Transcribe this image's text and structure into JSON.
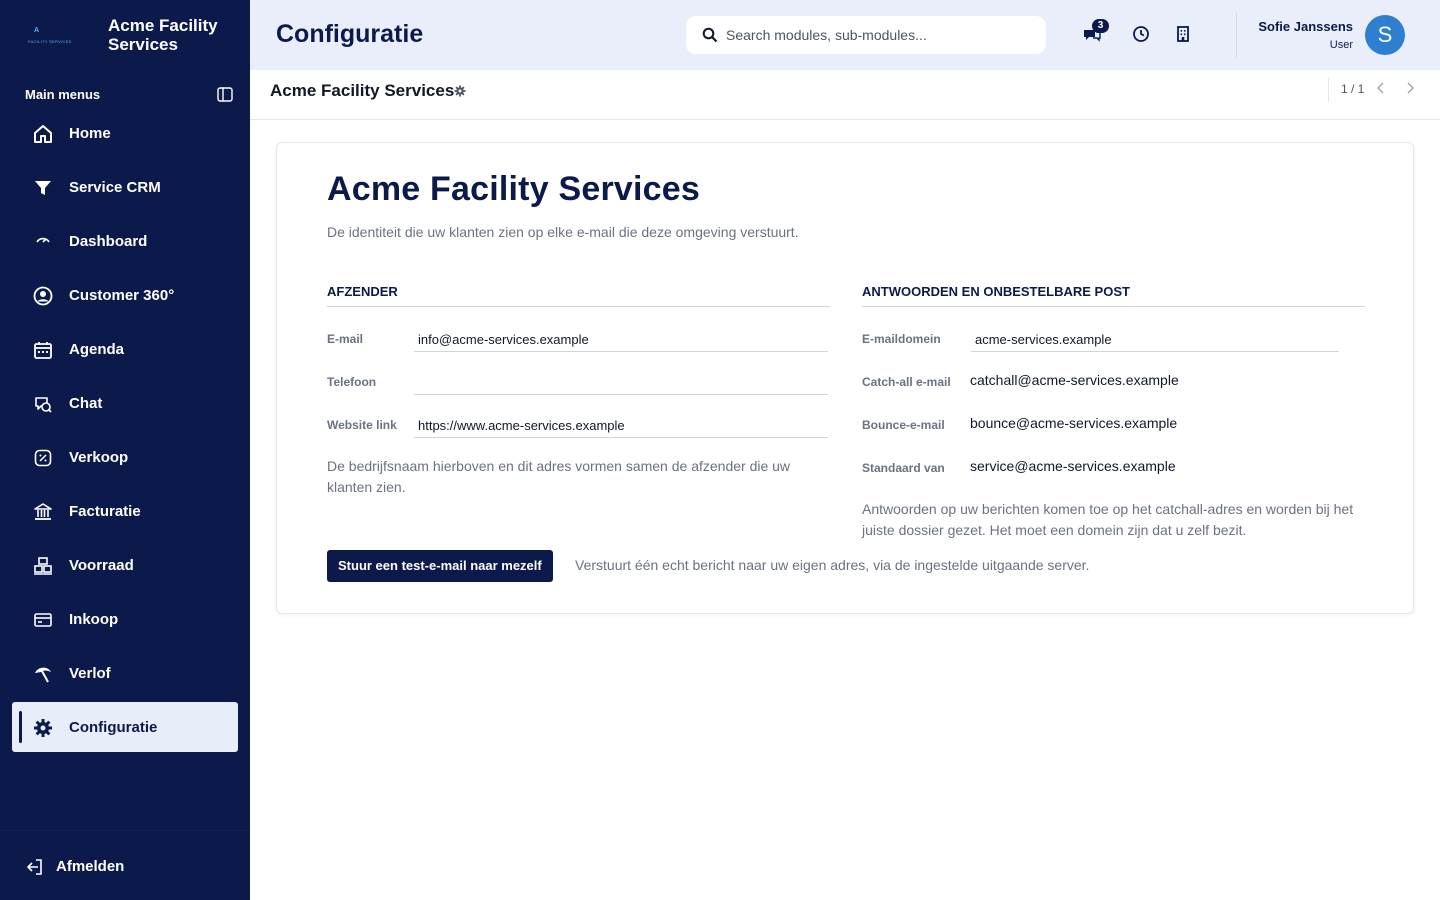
{
  "brand": {
    "name": "Acme Facility Services",
    "logo_letter": "A",
    "logo_sub": "FACILITY SERVICES"
  },
  "sidebar": {
    "heading": "Main menus",
    "items": [
      {
        "label": "Home",
        "icon": "home-icon"
      },
      {
        "label": "Service CRM",
        "icon": "filter-icon"
      },
      {
        "label": "Dashboard",
        "icon": "gauge-icon"
      },
      {
        "label": "Customer 360°",
        "icon": "user-circle-icon"
      },
      {
        "label": "Agenda",
        "icon": "calendar-icon"
      },
      {
        "label": "Chat",
        "icon": "chat-icon"
      },
      {
        "label": "Verkoop",
        "icon": "sales-icon"
      },
      {
        "label": "Facturatie",
        "icon": "bank-icon"
      },
      {
        "label": "Voorraad",
        "icon": "inventory-icon"
      },
      {
        "label": "Inkoop",
        "icon": "card-icon"
      },
      {
        "label": "Verlof",
        "icon": "leave-icon"
      },
      {
        "label": "Configuratie",
        "icon": "gear-icon",
        "active": true
      }
    ],
    "logout_label": "Afmelden"
  },
  "header": {
    "title": "Configuratie",
    "search_placeholder": "Search modules, sub-modules...",
    "chat_badge": "3",
    "user_name": "Sofie Janssens",
    "user_role": "User",
    "avatar_initial": "S"
  },
  "record": {
    "title": "Acme Facility Services",
    "pager": "1 / 1"
  },
  "card": {
    "title": "Acme Facility Services",
    "subtitle": "De identiteit die uw klanten zien op elke e-mail die deze omgeving verstuurt.",
    "sender": {
      "heading": "AFZENDER",
      "email_label": "E-mail",
      "email_value": "info@acme-services.example",
      "phone_label": "Telefoon",
      "phone_value": "",
      "website_label": "Website link",
      "website_value": "https://www.acme-services.example",
      "help": "De bedrijfsnaam hierboven en dit adres vormen samen de afzender die uw klanten zien."
    },
    "replies": {
      "heading": "ANTWOORDEN EN ONBESTELBARE POST",
      "domain_label": "E-maildomein",
      "domain_value": "acme-services.example",
      "catchall_label": "Catch-all e-mail",
      "catchall_value": "catchall@acme-services.example",
      "bounce_label": "Bounce-e-mail",
      "bounce_value": "bounce@acme-services.example",
      "default_from_label": "Standaard van",
      "default_from_value": "service@acme-services.example",
      "help": "Antwoorden op uw berichten komen toe op het catchall-adres en worden bij het juiste dossier gezet. Het moet een domein zijn dat u zelf bezit."
    },
    "test_button": "Stuur een test-e-mail naar mezelf",
    "test_help": "Verstuurt één echt bericht naar uw eigen adres, via de ingestelde uitgaande server."
  },
  "colors": {
    "sidebar_bg": "#0b1a4a",
    "header_bg": "#e9eefa",
    "accent": "#0b1a4a",
    "avatar": "#2f7fd0"
  }
}
